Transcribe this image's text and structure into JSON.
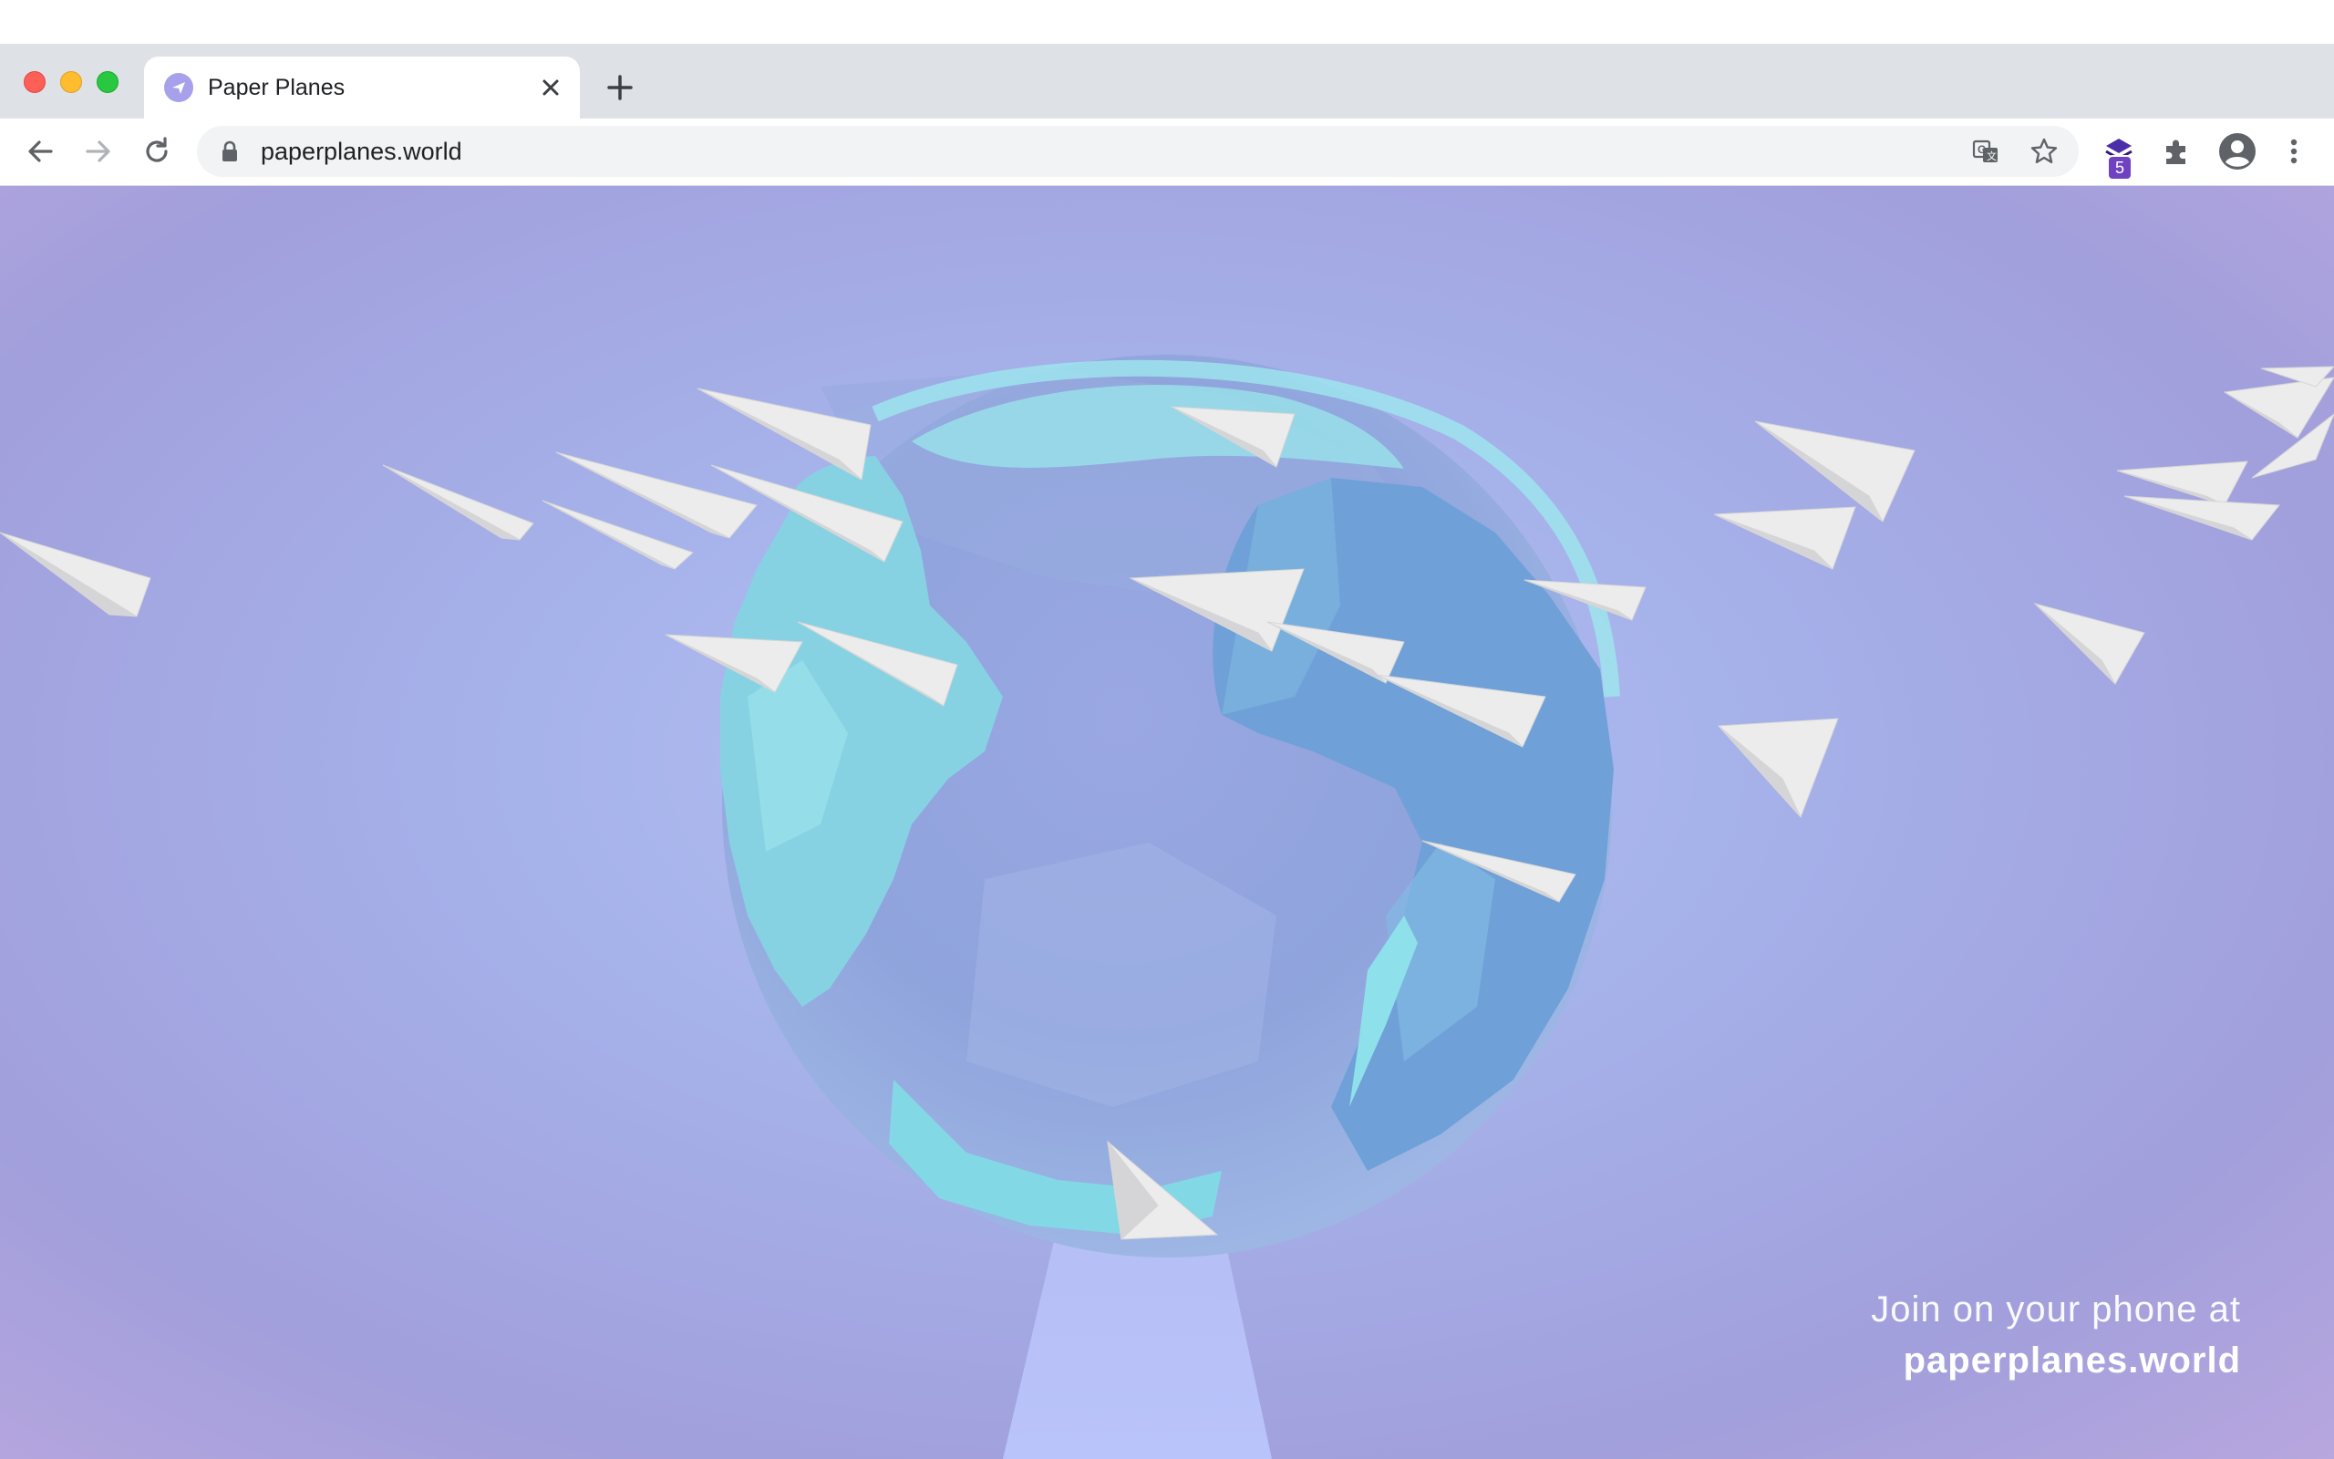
{
  "browser": {
    "tab": {
      "title": "Paper Planes",
      "favicon": "paper-plane-icon"
    },
    "address_bar": {
      "url": "paperplanes.world"
    },
    "extension_badge": "5",
    "colors": {
      "tab_strip": "#dee1e6",
      "accent_badge": "#6f42c1"
    }
  },
  "page": {
    "join_text": "Join on your phone at",
    "join_url": "paperplanes.world",
    "colors": {
      "sky": "#a6b2ea",
      "globe_land": "#8ad4e6",
      "globe_ocean": "#98acdf",
      "plane": "#ececec"
    }
  }
}
